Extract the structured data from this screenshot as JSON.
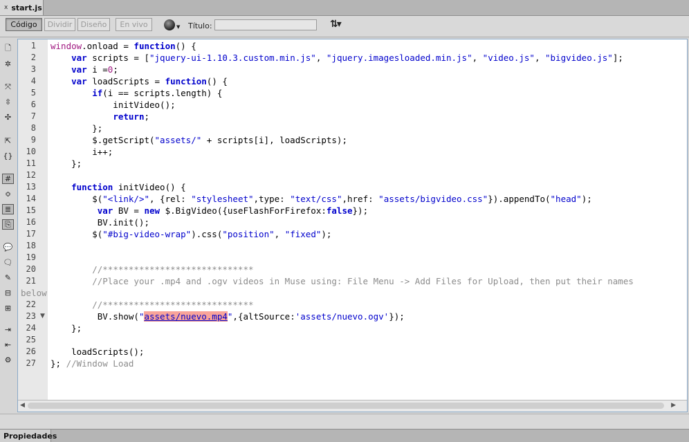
{
  "document_tab": {
    "name": "start.js",
    "close_glyph": "x"
  },
  "toolbar": {
    "code_label": "Código",
    "split_label": "Dividir",
    "design_label": "Diseño",
    "live_label": "En vivo",
    "title_label": "Título:",
    "title_value": ""
  },
  "editor": {
    "line_numbers": [
      "1",
      "2",
      "3",
      "4",
      "5",
      "6",
      "7",
      "8",
      "9",
      "10",
      "11",
      "12",
      "13",
      "14",
      "15",
      "16",
      "17",
      "18",
      "19",
      "20",
      "21",
      "",
      "22",
      "23",
      "24",
      "25",
      "26",
      "27"
    ],
    "fold_marker": "▼"
  },
  "properties_tab": "Propiedades",
  "colors": {
    "keyword": "#0000cc",
    "variable": "#a01880",
    "comment": "#8c8c8c",
    "highlight": "#f8a49a"
  }
}
